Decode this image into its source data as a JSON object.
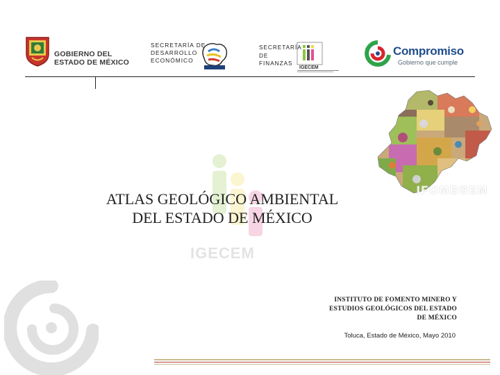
{
  "header": {
    "gobierno": {
      "line1": "GOBIERNO DEL",
      "line2": "ESTADO DE MÉXICO"
    },
    "sedeco": {
      "text": "SECRETARÍA DE\nDESARROLLO\nECONÓMICO"
    },
    "finanzas": {
      "text": "SECRETARÍA\nDE\nFINANZAS"
    },
    "igecem_small": {
      "label": "IGECEM"
    },
    "compromiso": {
      "word": "Compromiso",
      "tagline": "Gobierno que cumple"
    }
  },
  "watermarks": {
    "igecem": "IGECEM",
    "ifomegem": "IFOMEGEM"
  },
  "title": {
    "line1": "ATLAS GEOLÓGICO AMBIENTAL",
    "line2": "DEL ESTADO DE MÉXICO"
  },
  "institute": {
    "line1": "INSTITUTO DE FOMENTO MINERO Y",
    "line2": "ESTUDIOS GEOLÓGICOS DEL ESTADO",
    "line3": "DE MÉXICO"
  },
  "place_date": "Toluca, Estado de México, Mayo 2010",
  "colors": {
    "brand_blue": "#1f4e8c",
    "compromiso_green": "#2fa34a",
    "compromiso_red": "#d8262e",
    "igecem_green": "#8cc63f",
    "igecem_yellow": "#f2d83b",
    "igecem_pink": "#e4508f"
  }
}
